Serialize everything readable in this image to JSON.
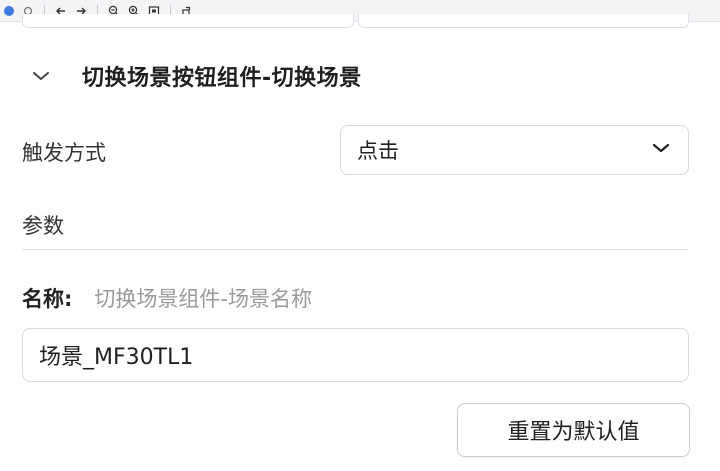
{
  "section": {
    "title": "切换场景按钮组件-切换场景"
  },
  "trigger": {
    "label": "触发方式",
    "value": "点击"
  },
  "params": {
    "label": "参数"
  },
  "name": {
    "label": "名称:",
    "hint": "切换场景组件-场景名称",
    "value": "场景_MF30TL1"
  },
  "reset_button": {
    "label": "重置为默认值"
  },
  "toolbar": {
    "icons": [
      "app-icon",
      "back-arrow-icon",
      "forward-arrow-icon",
      "zoom-out-icon",
      "zoom-in-icon",
      "fit-screen-icon",
      "rotate-icon"
    ]
  }
}
